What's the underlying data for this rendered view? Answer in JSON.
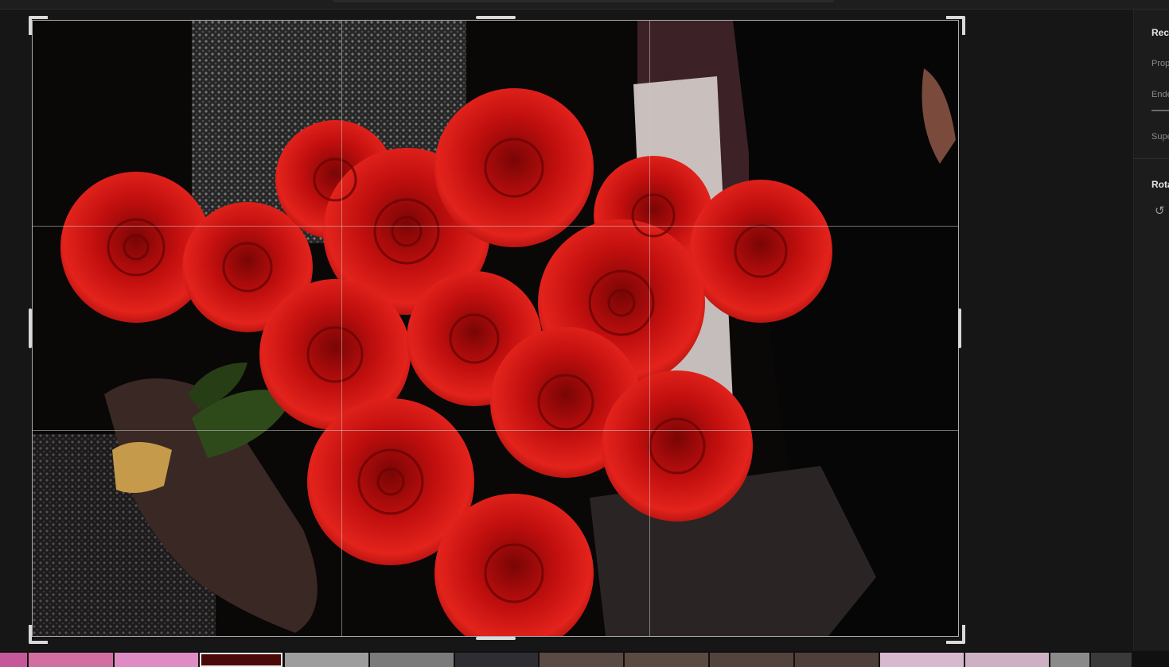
{
  "window": {
    "title": ""
  },
  "right_panel": {
    "section1_title": "Rec",
    "proportion_label": "Prop",
    "straighten_label": "Ende",
    "superimpose_label": "Supe",
    "section2_title": "Rota",
    "rotate_icon": "rotate-ccw-icon"
  },
  "photo": {
    "subject": "",
    "grid": "rule-of-thirds"
  },
  "filmstrip": {
    "thumbnails": [
      {
        "color": "#c4589a",
        "selected": false
      },
      {
        "color": "#d06fa0",
        "selected": false
      },
      {
        "color": "#e08cc4",
        "selected": false
      },
      {
        "color": "#4a0808",
        "selected": true
      },
      {
        "color": "#9d9d9d",
        "selected": false
      },
      {
        "color": "#7b7b7b",
        "selected": false
      },
      {
        "color": "#2d2d33",
        "selected": false
      },
      {
        "color": "#5a4a44",
        "selected": false
      },
      {
        "color": "#5b4a42",
        "selected": false
      },
      {
        "color": "#53433d",
        "selected": false
      },
      {
        "color": "#4e3f3a",
        "selected": false
      },
      {
        "color": "#d7b9cf",
        "selected": false
      },
      {
        "color": "#cdb0c4",
        "selected": false
      },
      {
        "color": "#8a8a8a",
        "selected": false
      },
      {
        "color": "#3a3a3a",
        "selected": false
      }
    ]
  },
  "colors": {
    "background": "#161616",
    "panel": "#1c1c1c",
    "rose": "#c8100f",
    "handle": "#d9d9d9"
  }
}
